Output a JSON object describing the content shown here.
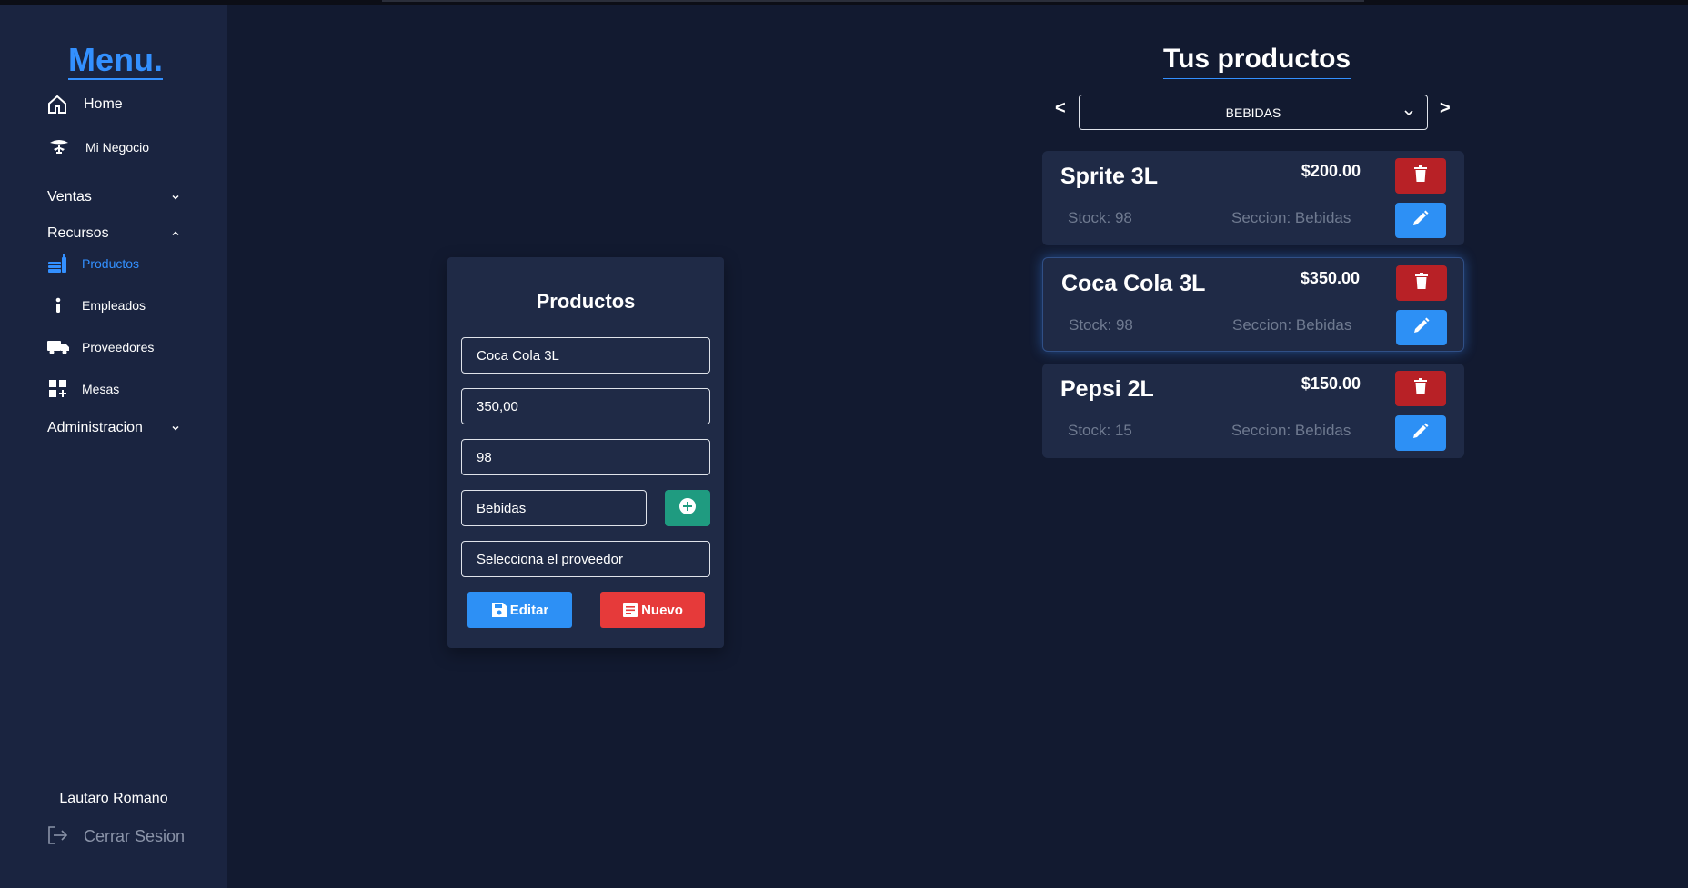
{
  "sidebar": {
    "title": "Menu.",
    "items": [
      {
        "label": "Home",
        "icon": "home-icon"
      },
      {
        "label": "Mi Negocio",
        "icon": "business-icon"
      }
    ],
    "groups": {
      "ventas": "Ventas",
      "recursos": "Recursos",
      "administracion": "Administracion"
    },
    "recursos_items": [
      {
        "label": "Productos",
        "icon": "products-icon",
        "active": true
      },
      {
        "label": "Empleados",
        "icon": "employee-icon"
      },
      {
        "label": "Proveedores",
        "icon": "truck-icon"
      },
      {
        "label": "Mesas",
        "icon": "tables-icon"
      }
    ],
    "user_name": "Lautaro Romano",
    "logout_label": "Cerrar Sesion"
  },
  "form": {
    "title": "Productos",
    "name_value": "Coca Cola 3L",
    "price_value": "350,00",
    "stock_value": "98",
    "section_value": "Bebidas",
    "provider_value": "Selecciona el proveedor",
    "edit_label": "Editar",
    "new_label": "Nuevo"
  },
  "list": {
    "title": "Tus productos",
    "prev": "<",
    "next": ">",
    "selected_category": "BEBIDAS",
    "products": [
      {
        "name": "Sprite 3L",
        "price": "$200.00",
        "stock": "Stock: 98",
        "section": "Seccion: Bebidas"
      },
      {
        "name": "Coca Cola 3L",
        "price": "$350.00",
        "stock": "Stock: 98",
        "section": "Seccion: Bebidas"
      },
      {
        "name": "Pepsi 2L",
        "price": "$150.00",
        "stock": "Stock: 15",
        "section": "Seccion: Bebidas"
      }
    ]
  },
  "colors": {
    "background": "#121a30",
    "sidebar": "#1a2440",
    "card": "#1f2a46",
    "accent": "#3390ff",
    "danger": "#b82126",
    "success": "#1f9b80"
  }
}
